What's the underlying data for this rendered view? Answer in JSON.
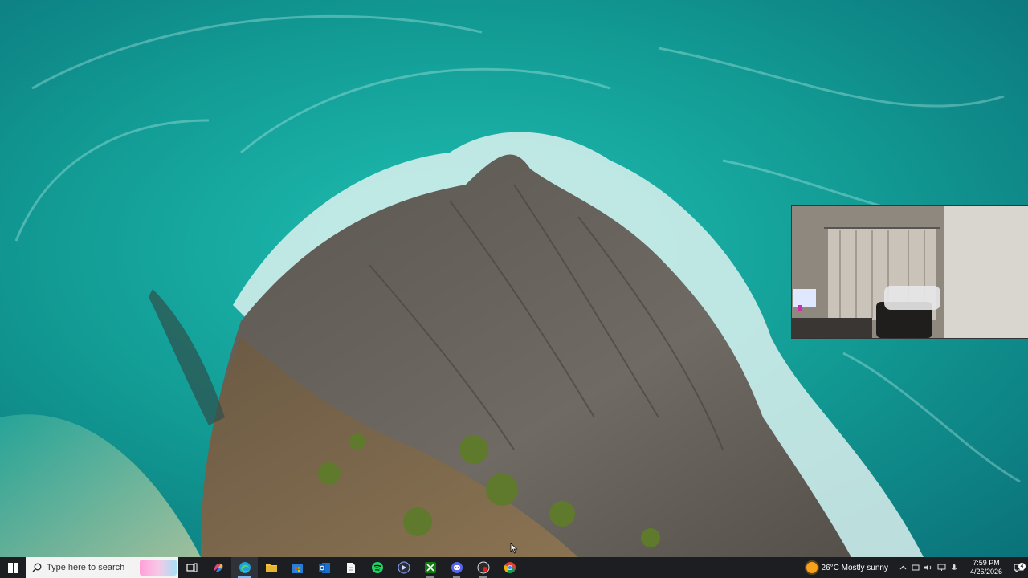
{
  "desktop": {
    "wallpaper": "aerial-coastline-rocky-headland",
    "colors": {
      "sea": "#129b94",
      "foam": "#e8f6f4",
      "rock": "#6f6a63",
      "taskbar": "#1c1e22"
    }
  },
  "webcam_overlay": {
    "content": "room-camera-feed"
  },
  "taskbar": {
    "search": {
      "placeholder": "Type here to search"
    },
    "apps": [
      {
        "name": "task-view",
        "icon": "task-view-icon"
      },
      {
        "name": "copilot",
        "icon": "copilot-icon"
      },
      {
        "name": "edge",
        "icon": "edge-icon",
        "state": "active"
      },
      {
        "name": "file-explorer",
        "icon": "folder-icon"
      },
      {
        "name": "microsoft-store",
        "icon": "store-icon"
      },
      {
        "name": "outlook",
        "icon": "outlook-icon"
      },
      {
        "name": "notepad",
        "icon": "document-icon"
      },
      {
        "name": "spotify",
        "icon": "spotify-icon"
      },
      {
        "name": "media-app",
        "icon": "play-icon"
      },
      {
        "name": "xbox",
        "icon": "xbox-icon",
        "state": "running"
      },
      {
        "name": "discord",
        "icon": "discord-icon",
        "state": "running"
      },
      {
        "name": "obs",
        "icon": "record-icon",
        "state": "running"
      },
      {
        "name": "chrome",
        "icon": "chrome-icon"
      }
    ],
    "weather": {
      "temp": "26°C",
      "condition": "Mostly sunny"
    },
    "clock": {
      "time": "7:59 PM",
      "date": "4/26/2026"
    },
    "notifications": {
      "count": "4"
    }
  }
}
